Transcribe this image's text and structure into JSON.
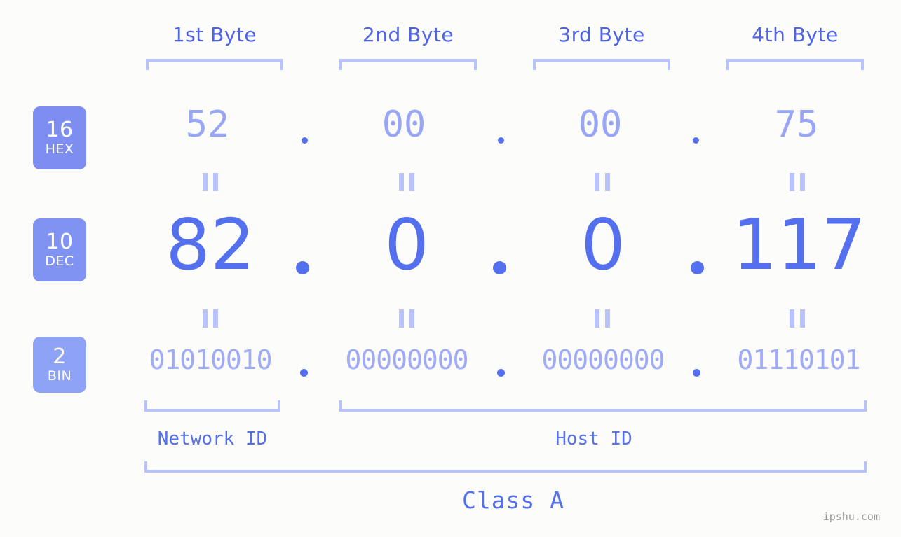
{
  "background_color": "#fcfdfa",
  "accent_color": "#5570ef",
  "light_accent_color": "#b9c2fa",
  "header": {
    "bytes": [
      {
        "label": "1st Byte"
      },
      {
        "label": "2nd Byte"
      },
      {
        "label": "3rd Byte"
      },
      {
        "label": "4th Byte"
      }
    ]
  },
  "rows": {
    "hex": {
      "badge_number": "16",
      "badge_name": "HEX",
      "badge_color": "#7d8df0",
      "values": [
        "52",
        "00",
        "00",
        "75"
      ],
      "separator": "."
    },
    "dec": {
      "badge_number": "10",
      "badge_name": "DEC",
      "badge_color": "#8093f2",
      "values": [
        "82",
        "0",
        "0",
        "117"
      ],
      "separator": "."
    },
    "bin": {
      "badge_number": "2",
      "badge_name": "BIN",
      "badge_color": "#8ea3f6",
      "values": [
        "01010010",
        "00000000",
        "00000000",
        "01110101"
      ],
      "separator": "."
    }
  },
  "equals_marks": {
    "glyph": "=",
    "count_per_row": 4
  },
  "footer": {
    "network_id_label": "Network ID",
    "host_id_label": "Host ID",
    "class_label": "Class A"
  },
  "watermark": {
    "text": "ipshu.com"
  }
}
